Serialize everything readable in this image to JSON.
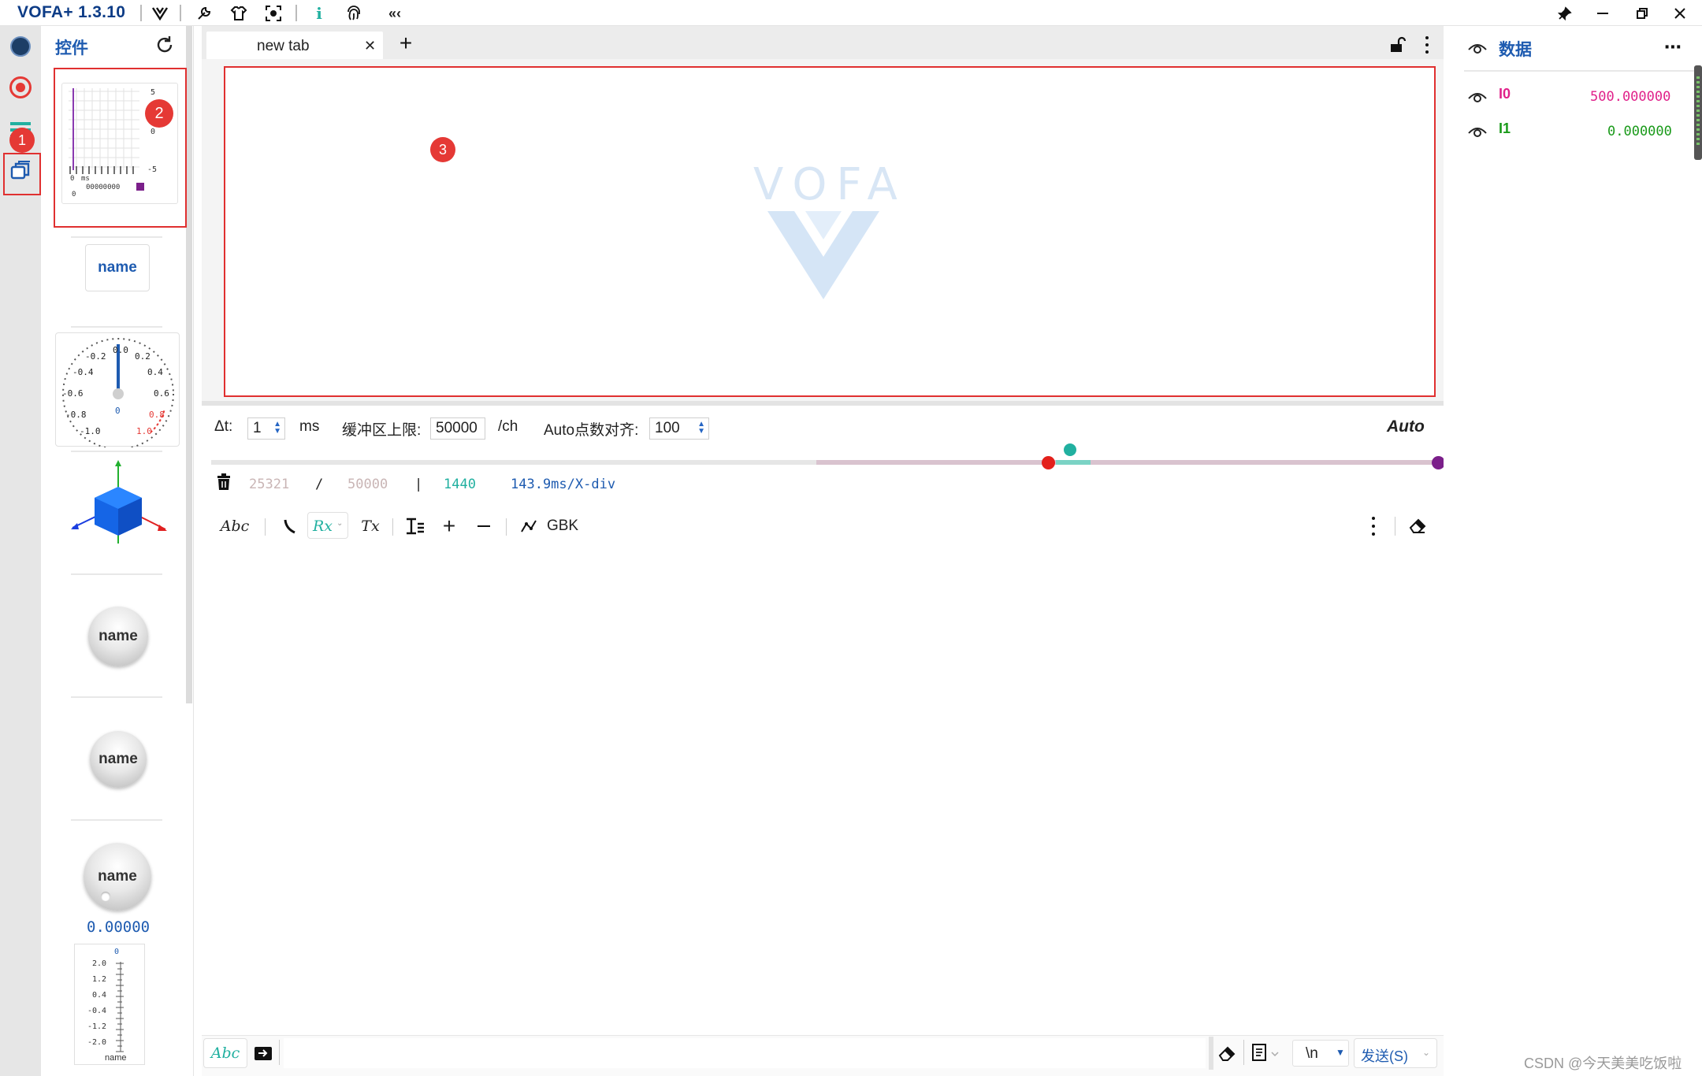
{
  "titlebar": {
    "app_title": "VOFA+ 1.3.10",
    "icons": [
      "vofa-logo-icon",
      "wrench-icon",
      "shirt-icon",
      "screenshot-icon",
      "info-icon",
      "fingerprint-icon",
      "collapse-icon"
    ],
    "window_buttons": [
      "pin-icon",
      "minimize-icon",
      "maximize-icon",
      "close-icon"
    ]
  },
  "rail": {
    "items": [
      "connection-status-icon",
      "record-icon",
      "protocol-menu-icon",
      "widgets-icon"
    ]
  },
  "widget_panel": {
    "title": "控件",
    "button_widget_label": "name",
    "knob_labels": [
      "name",
      "name",
      "name"
    ],
    "knob_value": "0.00000",
    "plot_thumb_ticks_y": [
      "5",
      "0",
      "-5"
    ],
    "plot_thumb_x_label": "ms",
    "plot_thumb_x_start": "0",
    "plot_thumb_counter": "0",
    "gauge_ticks_left": [
      "-0.2",
      "-0.4",
      "-0.6",
      "-0.8",
      "-1.0"
    ],
    "gauge_ticks_right": [
      "0.2",
      "0.4",
      "0.6",
      "0.8",
      "1.0"
    ],
    "gauge_top": "0.0",
    "gauge_center": "0",
    "slider_ticks": [
      "0",
      "2.0",
      "1.2",
      "0.4",
      "-0.4",
      "-1.2",
      "-2.0"
    ],
    "slider_label": "name"
  },
  "tabs": [
    {
      "label": "new tab"
    }
  ],
  "plot": {
    "watermark": "VOFA"
  },
  "controls": {
    "dt_label": "Δt:",
    "dt_value": "1",
    "dt_unit": "ms",
    "buffer_label": "缓冲区上限:",
    "buffer_value": "50000",
    "buffer_unit": "/ch",
    "align_label": "Auto点数对齐:",
    "align_value": "100",
    "auto_label": "Auto"
  },
  "stats": {
    "count": "25321",
    "sep1": "/",
    "max": "50000",
    "sep2": "|",
    "points": "1440",
    "xdiv": "143.9ms/X-div"
  },
  "console_toolbar": {
    "abc": "Abc",
    "rx": "Rx",
    "tx": "Tx",
    "encoding": "GBK"
  },
  "send_bar": {
    "abc": "Abc",
    "newline": "\\n",
    "send_label": "发送(S)"
  },
  "data_panel": {
    "title": "数据",
    "channels": [
      {
        "name": "I0",
        "value": "500.000000",
        "color": "#e0218a"
      },
      {
        "name": "I1",
        "value": "0.000000",
        "color": "#1a9a1a"
      }
    ]
  },
  "markers": [
    "1",
    "2",
    "3"
  ],
  "watermark_credit": "CSDN @今天美美吃饭啦",
  "colors": {
    "accent": "#1e5bb0",
    "highlight": "#e03030",
    "teal": "#21b0a0",
    "purple": "#7b1f8a"
  }
}
